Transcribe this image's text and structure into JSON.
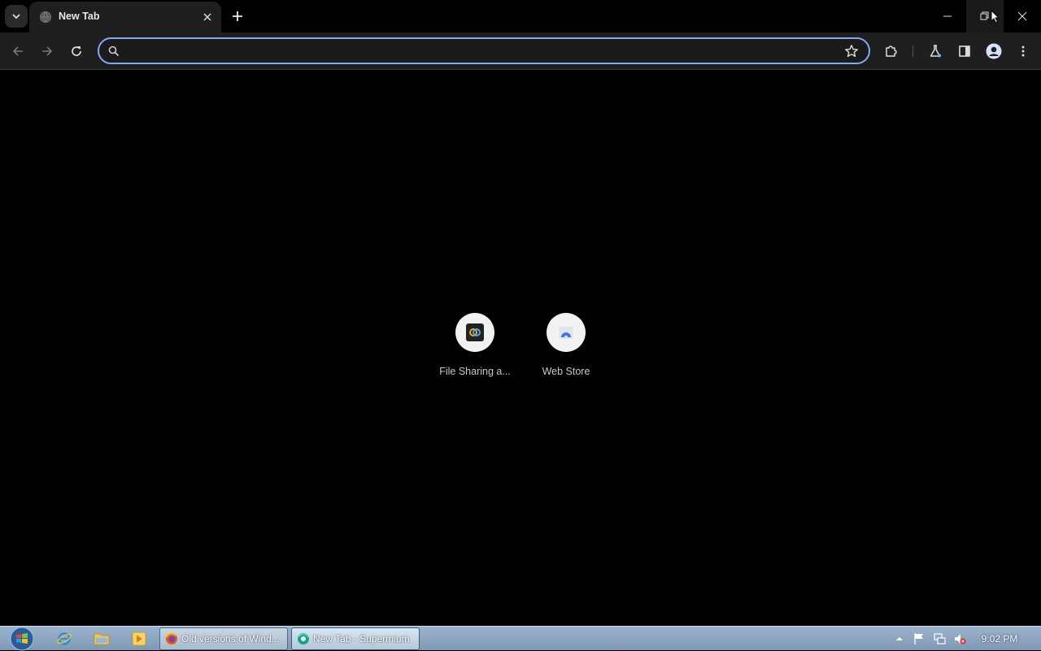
{
  "tab": {
    "title": "New Tab"
  },
  "omnibox": {
    "value": "",
    "placeholder": ""
  },
  "shortcuts": [
    {
      "label": "File Sharing a...",
      "icon": "file-sharing-icon"
    },
    {
      "label": "Web Store",
      "icon": "web-store-icon"
    }
  ],
  "taskbar": {
    "tasks": [
      {
        "label": "Old versions of Wind...",
        "icon": "firefox-icon"
      },
      {
        "label": "New Tab - Supermium",
        "icon": "supermium-icon"
      }
    ],
    "clock": "9:02 PM"
  },
  "colors": {
    "omnibox_focus_ring": "#7cacf8",
    "toolbar": "#1f1f1f",
    "page_background": "#000000"
  }
}
